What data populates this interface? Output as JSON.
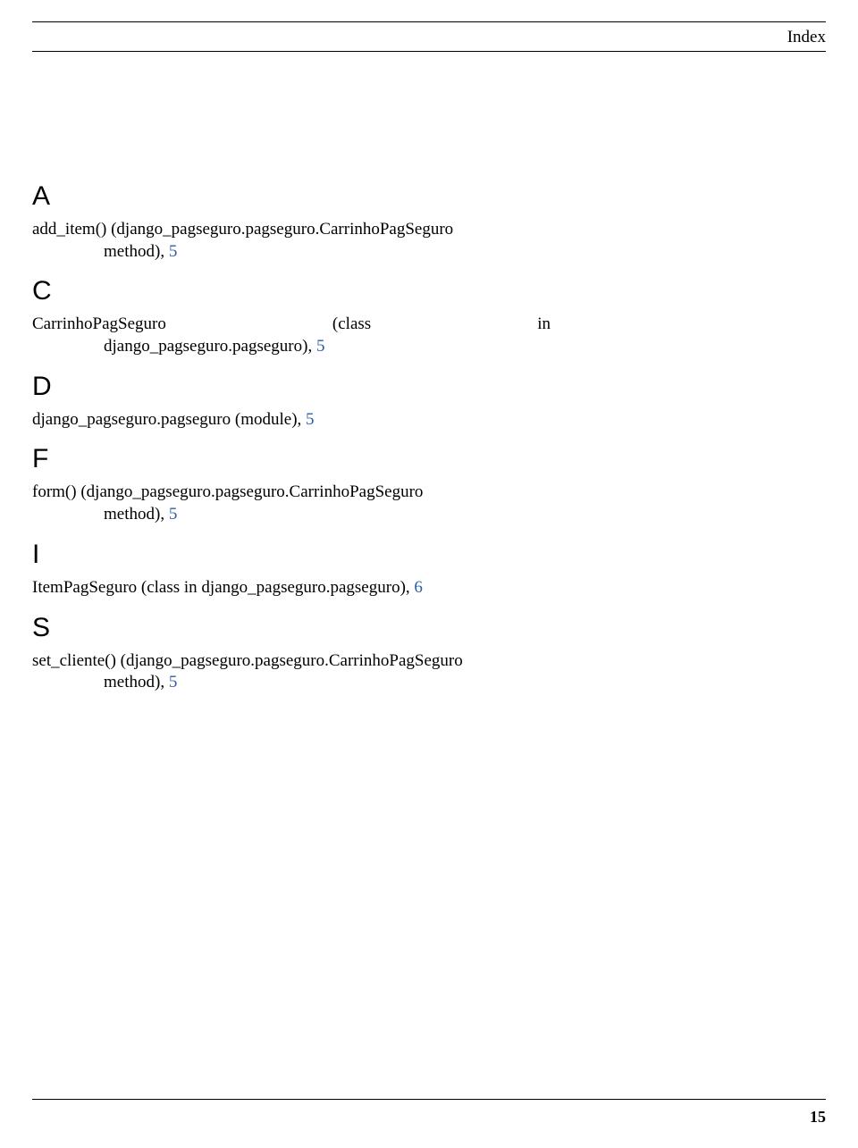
{
  "header": {
    "title": "Index"
  },
  "sections": {
    "A": {
      "letter": "A",
      "entry": {
        "line1": "add_item() (django_pagseguro.pagseguro.CarrinhoPagSeguro",
        "line2_prefix": "method), ",
        "page": "5"
      }
    },
    "C": {
      "letter": "C",
      "entry": {
        "row_a": "CarrinhoPagSeguro",
        "row_b": "(class",
        "row_c": "in",
        "line2_prefix": "django_pagseguro.pagseguro), ",
        "page": "5"
      }
    },
    "D": {
      "letter": "D",
      "entry": {
        "text": "django_pagseguro.pagseguro (module), ",
        "page": "5"
      }
    },
    "F": {
      "letter": "F",
      "entry": {
        "line1": "form() (django_pagseguro.pagseguro.CarrinhoPagSeguro",
        "line2_prefix": "method), ",
        "page": "5"
      }
    },
    "I": {
      "letter": "I",
      "entry": {
        "text": "ItemPagSeguro (class in django_pagseguro.pagseguro), ",
        "page": "6"
      }
    },
    "S": {
      "letter": "S",
      "entry": {
        "line1": "set_cliente() (django_pagseguro.pagseguro.CarrinhoPagSeguro",
        "line2_prefix": "method), ",
        "page": "5"
      }
    }
  },
  "footer": {
    "page_number": "15"
  }
}
